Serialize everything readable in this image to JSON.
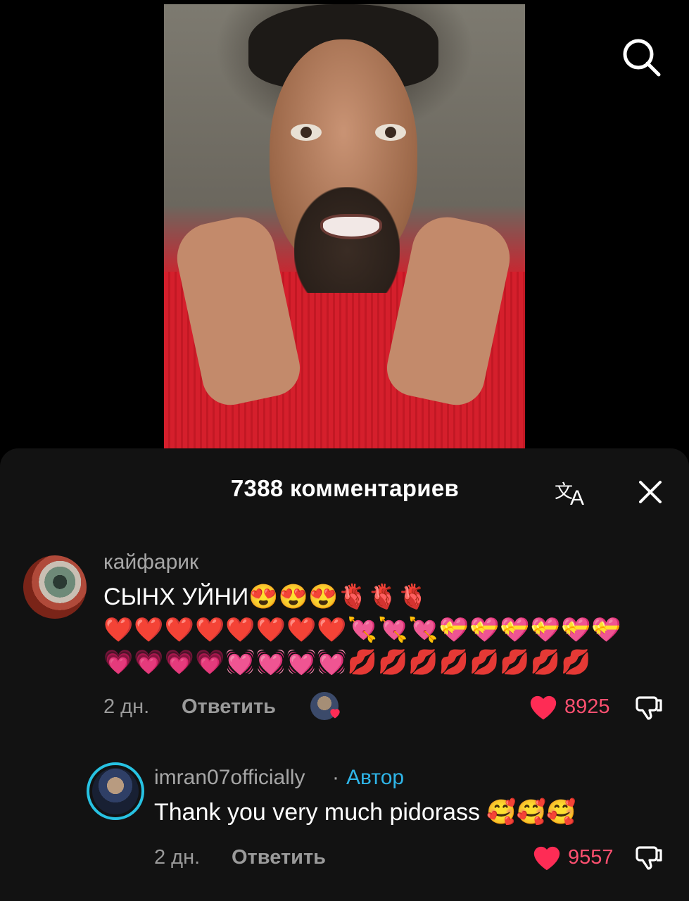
{
  "video": {
    "search_icon": "search-icon"
  },
  "sheet": {
    "title": "7388 комментариев",
    "translate_icon": "translate-icon",
    "close_icon": "close-icon"
  },
  "comments": [
    {
      "username": "кайфарик",
      "text": "СЫНХ УЙНИ😍😍😍🫀🫀🫀",
      "emoji_line_2": "❤️❤️❤️❤️❤️❤️❤️❤️💘💘💘💝💝💝💝💝💝",
      "emoji_line_3": "💗💗💗💗💓💓💓💓💋💋💋💋💋💋💋💋",
      "time": "2 дн.",
      "reply_label": "Ответить",
      "likes": "8925",
      "like_color": "#fe2c55"
    },
    {
      "username": "imran07officially",
      "separator": "·",
      "author_badge": "Автор",
      "text": "Thank you very much pidorass 🥰🥰🥰",
      "time": "2 дн.",
      "reply_label": "Ответить",
      "likes": "9557",
      "like_color": "#fe2c55"
    }
  ]
}
